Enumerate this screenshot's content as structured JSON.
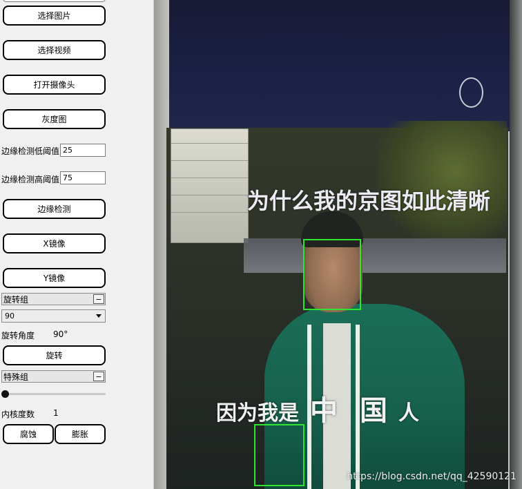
{
  "controls": {
    "select_image_label": "选择图片",
    "select_video_label": "选择视频",
    "open_camera_label": "打开摄像头",
    "grayscale_label": "灰度图",
    "edge_low_label": "边缘检测低阈值",
    "edge_low_value": "25",
    "edge_high_label": "边缘检测高阈值",
    "edge_high_value": "75",
    "edge_detect_label": "边缘检测",
    "x_mirror_label": "X镜像",
    "y_mirror_label": "Y镜像",
    "rotate_group": {
      "title": "旋转组",
      "toggle": "−",
      "selected_option": "90",
      "angle_label": "旋转角度",
      "angle_value": "90°",
      "rotate_label": "旋转"
    },
    "special_group": {
      "title": "特殊组",
      "toggle": "−",
      "kernel_label": "内核度数",
      "kernel_value": "1",
      "kernel_slider_fraction": 0,
      "erode_label": "腐蚀",
      "dilate_label": "膨胀"
    }
  },
  "display": {
    "subtitle_1": "为什么我的京图如此清晰",
    "subtitle_2_a": "因为我是",
    "subtitle_2_b": "中",
    "subtitle_2_c": "国",
    "subtitle_2_d": "人",
    "watermark": "https://blog.csdn.net/qq_42590121",
    "face_box_color": "#2ee62e"
  }
}
